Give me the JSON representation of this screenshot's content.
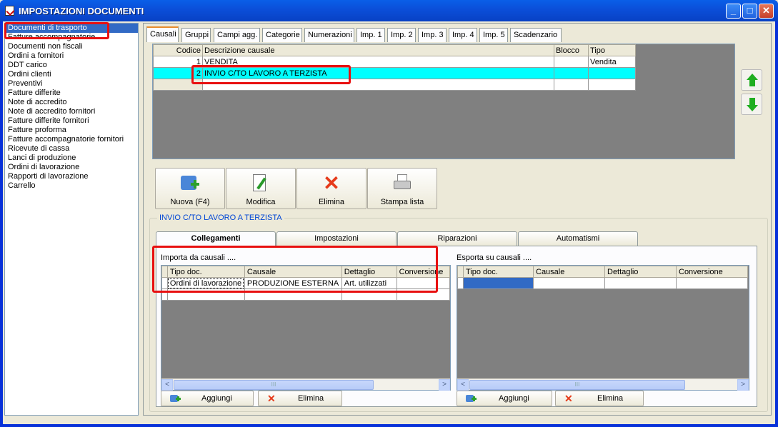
{
  "window": {
    "title": "IMPOSTAZIONI DOCUMENTI",
    "min": "_",
    "max": "□",
    "close": "✕"
  },
  "sidebar": {
    "items": [
      {
        "label": "Documenti di trasporto"
      },
      {
        "label": "Fatture accompagnatorie"
      },
      {
        "label": "Documenti non fiscali"
      },
      {
        "label": "Ordini a fornitori"
      },
      {
        "label": "DDT carico"
      },
      {
        "label": "Ordini clienti"
      },
      {
        "label": "Preventivi"
      },
      {
        "label": "Fatture differite"
      },
      {
        "label": "Note di accredito"
      },
      {
        "label": "Note di accredito fornitori"
      },
      {
        "label": "Fatture differite fornitori"
      },
      {
        "label": "Fatture proforma"
      },
      {
        "label": "Fatture accompagnatorie fornitori"
      },
      {
        "label": "Ricevute di cassa"
      },
      {
        "label": "Lanci di produzione"
      },
      {
        "label": "Ordini di lavorazione"
      },
      {
        "label": "Rapporti di lavorazione"
      },
      {
        "label": "Carrello"
      }
    ]
  },
  "tabs": [
    "Causali",
    "Gruppi",
    "Campi agg.",
    "Categorie",
    "Numerazioni",
    "Imp. 1",
    "Imp. 2",
    "Imp. 3",
    "Imp. 4",
    "Imp. 5",
    "Scadenzario"
  ],
  "causali": {
    "headers": [
      "Codice",
      "Descrizione causale",
      "Blocco",
      "Tipo"
    ],
    "rows": [
      {
        "codice": "1",
        "descrizione": "VENDITA",
        "blocco": "",
        "tipo": "Vendita"
      },
      {
        "codice": "2",
        "descrizione": "INVIO C/TO LAVORO A TERZISTA",
        "blocco": "",
        "tipo": ""
      }
    ]
  },
  "toolbar": {
    "nuova": "Nuova (F4)",
    "modifica": "Modifica",
    "elimina": "Elimina",
    "stampa": "Stampa lista"
  },
  "group": {
    "title": "INVIO C/TO LAVORO A TERZISTA"
  },
  "subtabs": [
    "Collegamenti",
    "Impostazioni",
    "Riparazioni",
    "Automatismi"
  ],
  "importa": {
    "label": "Importa da causali ....",
    "headers": [
      "Tipo doc.",
      "Causale",
      "Dettaglio",
      "Conversione"
    ],
    "rows": [
      {
        "tipo": "Ordini di lavorazione",
        "causale": "PRODUZIONE ESTERNA",
        "dettaglio": "Art. utilizzati",
        "conversione": ""
      }
    ],
    "aggiungi": "Aggiungi",
    "elimina": "Elimina"
  },
  "esporta": {
    "label": "Esporta su causali ....",
    "headers": [
      "Tipo doc.",
      "Causale",
      "Dettaglio",
      "Conversione"
    ],
    "aggiungi": "Aggiungi",
    "elimina": "Elimina"
  },
  "scroll": {
    "left": "<",
    "right": ">",
    "grip": "III"
  },
  "colors": {
    "accent": "#316ac5",
    "highlight": "#00ffff",
    "annotation": "#e81010"
  }
}
